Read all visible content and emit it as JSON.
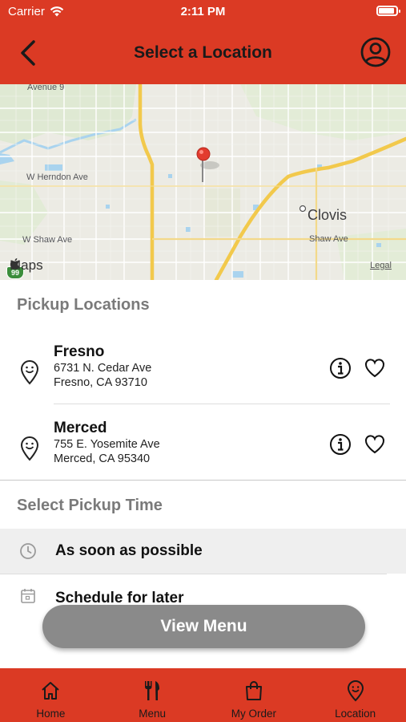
{
  "status_bar": {
    "carrier": "Carrier",
    "time": "2:11 PM",
    "battery_level": 0.9
  },
  "header": {
    "title": "Select a Location",
    "back_icon": "chevron-left-icon",
    "profile_icon": "user-circle-icon",
    "background_color": "#db3a24"
  },
  "map": {
    "street_labels": [
      "Avenue 9",
      "W Herndon Ave",
      "W Shaw Ave",
      "Shaw Ave"
    ],
    "city_label": "Clovis",
    "attribution": "Maps",
    "legal": "Legal",
    "highway_shield": "99"
  },
  "pickup": {
    "title": "Pickup Locations",
    "locations": [
      {
        "name": "Fresno",
        "address_line1": "6731 N. Cedar Ave",
        "address_line2": "Fresno, CA 93710"
      },
      {
        "name": "Merced",
        "address_line1": "755 E. Yosemite Ave",
        "address_line2": "Merced, CA 95340"
      }
    ]
  },
  "pickup_time": {
    "title": "Select Pickup Time",
    "options": [
      {
        "label": "As soon as possible",
        "icon": "clock-icon",
        "selected": true
      },
      {
        "label": "Schedule for later",
        "icon": "calendar-icon",
        "selected": false
      }
    ]
  },
  "cta": {
    "label": "View Menu",
    "color": "#8a8a8a"
  },
  "tabbar": {
    "tabs": [
      {
        "label": "Home",
        "icon": "home-icon"
      },
      {
        "label": "Menu",
        "icon": "fork-knife-icon"
      },
      {
        "label": "My Order",
        "icon": "shopping-bag-icon"
      },
      {
        "label": "Location",
        "icon": "location-pin-icon"
      }
    ]
  }
}
